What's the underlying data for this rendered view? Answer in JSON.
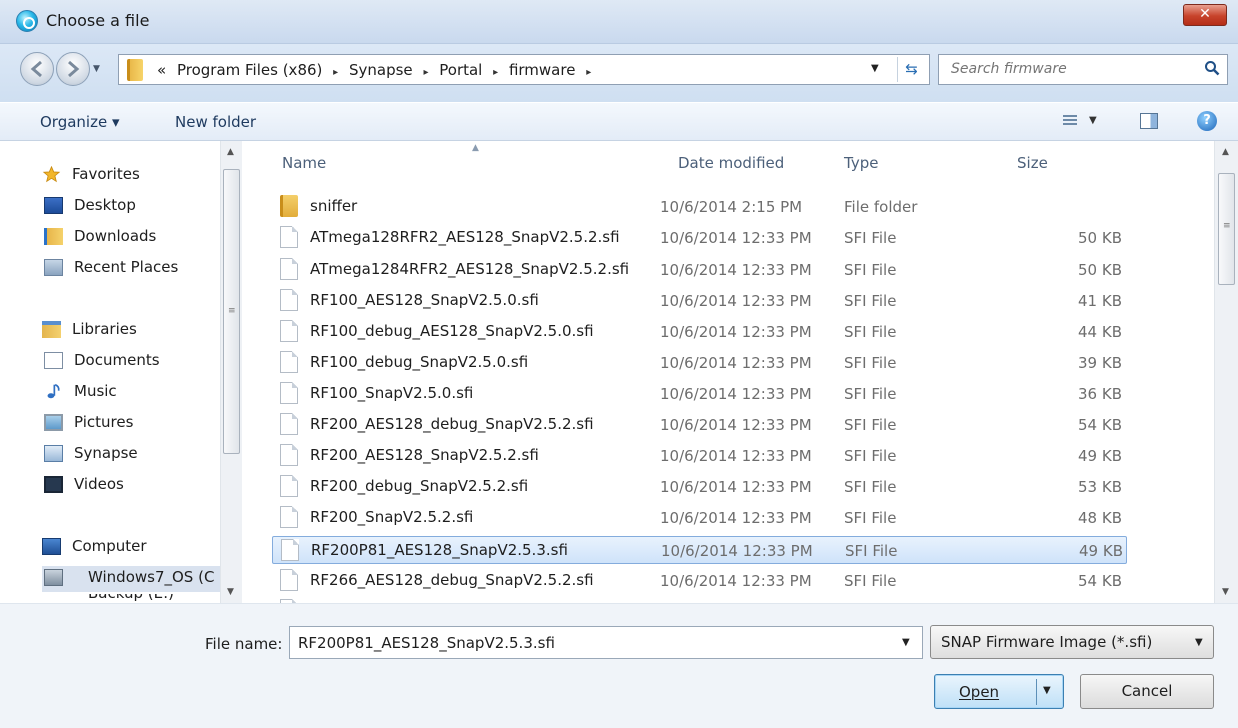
{
  "window": {
    "title": "Choose a file",
    "close_glyph": "✕"
  },
  "address": {
    "back_icon": "back-arrow-icon",
    "forward_icon": "forward-arrow-icon",
    "overflow": "«",
    "crumbs": [
      "Program Files (x86)",
      "Synapse",
      "Portal",
      "firmware"
    ],
    "separator": "▸",
    "dropdown_glyph": "▼",
    "refresh_glyph": "⇆"
  },
  "search": {
    "placeholder": "Search firmware"
  },
  "toolbar": {
    "organize_label": "Organize ▾",
    "new_folder_label": "New folder",
    "views_dropdown": "▼",
    "help_glyph": "?"
  },
  "nav": {
    "scroll_up": "▲",
    "scroll_down": "▼",
    "grip": "≡",
    "items": [
      {
        "label": "Favorites",
        "icon": "star-icon"
      },
      {
        "label": "Desktop",
        "icon": "desktop-icon"
      },
      {
        "label": "Downloads",
        "icon": "downloads-icon"
      },
      {
        "label": "Recent Places",
        "icon": "recent-places-icon"
      },
      {
        "label": "Libraries",
        "icon": "libraries-icon"
      },
      {
        "label": "Documents",
        "icon": "documents-icon"
      },
      {
        "label": "Music",
        "icon": "music-icon"
      },
      {
        "label": "Pictures",
        "icon": "pictures-icon"
      },
      {
        "label": "Synapse",
        "icon": "synapse-icon"
      },
      {
        "label": "Videos",
        "icon": "videos-icon"
      },
      {
        "label": "Computer",
        "icon": "computer-icon"
      },
      {
        "label": "Windows7_OS (C",
        "icon": "drive-icon"
      },
      {
        "label": "Backup (E:)",
        "icon": "drive-icon"
      }
    ]
  },
  "files": {
    "columns": {
      "name": "Name",
      "date": "Date modified",
      "type": "Type",
      "size": "Size"
    },
    "sort_glyph": "▲",
    "scroll_up": "▲",
    "scroll_down": "▼",
    "grip": "≡",
    "rows": [
      {
        "name": "sniffer",
        "date": "10/6/2014 2:15 PM",
        "type": "File folder",
        "size": "",
        "kind": "folder"
      },
      {
        "name": "ATmega128RFR2_AES128_SnapV2.5.2.sfi",
        "date": "10/6/2014 12:33 PM",
        "type": "SFI File",
        "size": "50 KB",
        "kind": "file"
      },
      {
        "name": "ATmega1284RFR2_AES128_SnapV2.5.2.sfi",
        "date": "10/6/2014 12:33 PM",
        "type": "SFI File",
        "size": "50 KB",
        "kind": "file"
      },
      {
        "name": "RF100_AES128_SnapV2.5.0.sfi",
        "date": "10/6/2014 12:33 PM",
        "type": "SFI File",
        "size": "41 KB",
        "kind": "file"
      },
      {
        "name": "RF100_debug_AES128_SnapV2.5.0.sfi",
        "date": "10/6/2014 12:33 PM",
        "type": "SFI File",
        "size": "44 KB",
        "kind": "file"
      },
      {
        "name": "RF100_debug_SnapV2.5.0.sfi",
        "date": "10/6/2014 12:33 PM",
        "type": "SFI File",
        "size": "39 KB",
        "kind": "file"
      },
      {
        "name": "RF100_SnapV2.5.0.sfi",
        "date": "10/6/2014 12:33 PM",
        "type": "SFI File",
        "size": "36 KB",
        "kind": "file"
      },
      {
        "name": "RF200_AES128_debug_SnapV2.5.2.sfi",
        "date": "10/6/2014 12:33 PM",
        "type": "SFI File",
        "size": "54 KB",
        "kind": "file"
      },
      {
        "name": "RF200_AES128_SnapV2.5.2.sfi",
        "date": "10/6/2014 12:33 PM",
        "type": "SFI File",
        "size": "49 KB",
        "kind": "file"
      },
      {
        "name": "RF200_debug_SnapV2.5.2.sfi",
        "date": "10/6/2014 12:33 PM",
        "type": "SFI File",
        "size": "53 KB",
        "kind": "file"
      },
      {
        "name": "RF200_SnapV2.5.2.sfi",
        "date": "10/6/2014 12:33 PM",
        "type": "SFI File",
        "size": "48 KB",
        "kind": "file"
      },
      {
        "name": "RF200P81_AES128_SnapV2.5.3.sfi",
        "date": "10/6/2014 12:33 PM",
        "type": "SFI File",
        "size": "49 KB",
        "kind": "file",
        "selected": true
      },
      {
        "name": "RF266_AES128_debug_SnapV2.5.2.sfi",
        "date": "10/6/2014 12:33 PM",
        "type": "SFI File",
        "size": "54 KB",
        "kind": "file"
      }
    ]
  },
  "bottom": {
    "filename_label": "File name:",
    "filename_value": "RF200P81_AES128_SnapV2.5.3.sfi",
    "dropdown_glyph": "▼",
    "filter_label": "SNAP Firmware Image (*.sfi)",
    "open_label": "Open",
    "cancel_label": "Cancel"
  }
}
